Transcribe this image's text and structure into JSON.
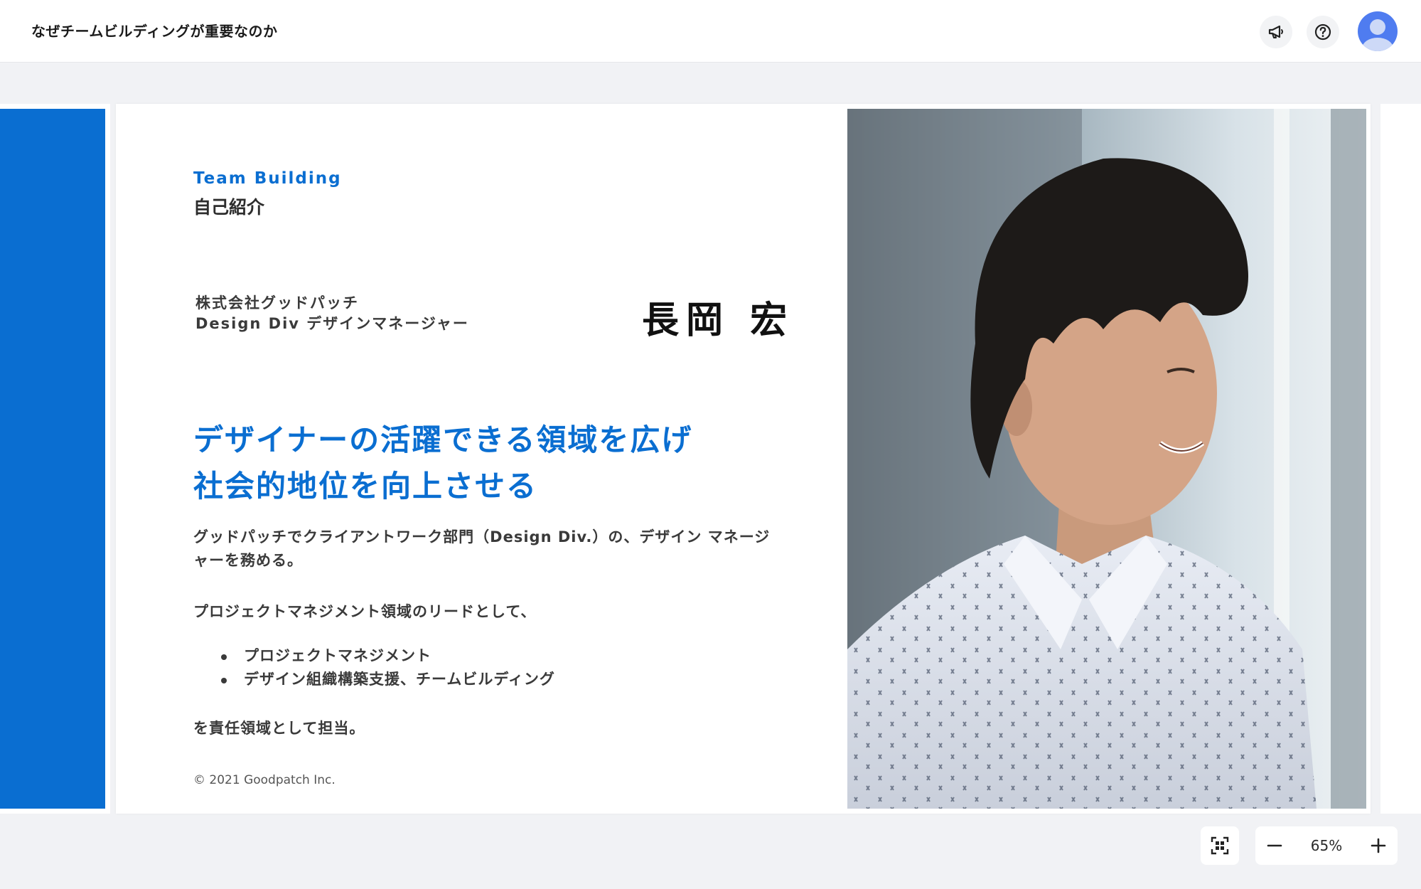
{
  "header": {
    "document_title": "なぜチームビルディングが重要なのか",
    "icons": [
      "megaphone-icon",
      "help-icon",
      "user-avatar"
    ]
  },
  "slide": {
    "kicker": "Team Building",
    "section_title": "自己紹介",
    "company_line1": "株式会社グッドパッチ",
    "company_line2": "Design Div デザインマネージャー",
    "person_name": "長岡 宏",
    "headline_line1": "デザイナーの活躍できる領域を広げ",
    "headline_line2": "社会的地位を向上させる",
    "body": "グッドパッチでクライアントワーク部門（Design Div.）の、デザイン マネージャーを務める。",
    "lead": "プロジェクトマネジメント領域のリードとして、",
    "bullets": [
      "プロジェクトマネジメント",
      "デザイン組織構築支援、チームビルディング"
    ],
    "closing": "を責任領域として担当。",
    "copyright": "© 2021 Goodpatch Inc.",
    "photo": "portrait-photo"
  },
  "zoom": {
    "value": "65%"
  },
  "colors": {
    "accent": "#0a6ed1",
    "canvas": "#f1f2f5",
    "avatar": "#4f7cf0"
  }
}
